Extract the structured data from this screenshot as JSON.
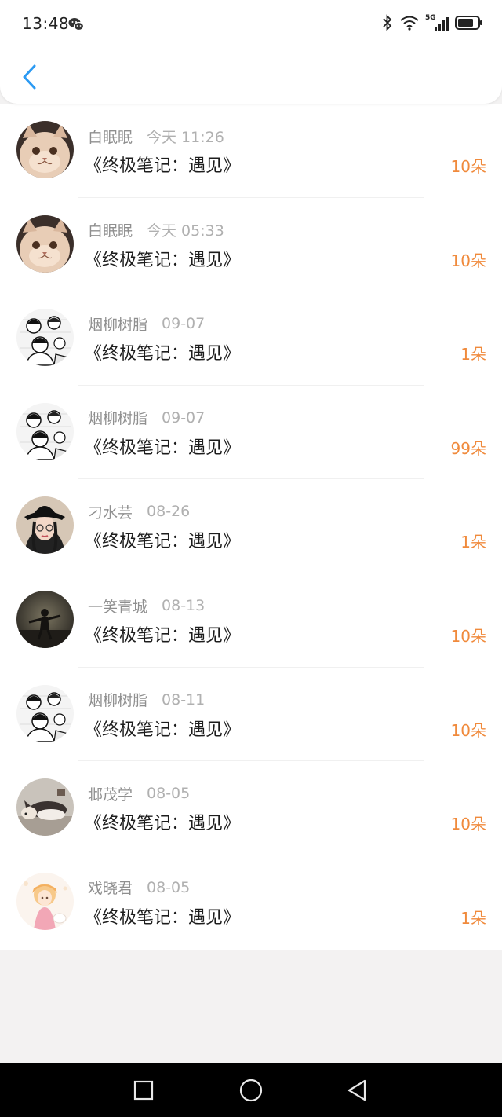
{
  "status_bar": {
    "time": "13:48",
    "network_label": "5G",
    "icons": [
      "wechat-icon",
      "bluetooth-icon",
      "wifi-icon",
      "cellular-signal-icon",
      "battery-icon"
    ]
  },
  "header": {
    "back_icon": "chevron-left-icon",
    "accent_color": "#2b9af3"
  },
  "list": {
    "amount_color": "#f08a3c",
    "items": [
      {
        "name": "白眠眠",
        "time": "今天 11:26",
        "title": "《终极笔记：遇见》",
        "amount": "10朵",
        "avatar": "cat"
      },
      {
        "name": "白眠眠",
        "time": "今天 05:33",
        "title": "《终极笔记：遇见》",
        "amount": "10朵",
        "avatar": "cat"
      },
      {
        "name": "烟柳树脂",
        "time": "09-07",
        "title": "《终极笔记：遇见》",
        "amount": "1朵",
        "avatar": "manga"
      },
      {
        "name": "烟柳树脂",
        "time": "09-07",
        "title": "《终极笔记：遇见》",
        "amount": "99朵",
        "avatar": "manga"
      },
      {
        "name": "刁水芸",
        "time": "08-26",
        "title": "《终极笔记：遇见》",
        "amount": "1朵",
        "avatar": "girl"
      },
      {
        "name": "一笑青城",
        "time": "08-13",
        "title": "《终极笔记：遇见》",
        "amount": "10朵",
        "avatar": "silhouette"
      },
      {
        "name": "烟柳树脂",
        "time": "08-11",
        "title": "《终极笔记：遇见》",
        "amount": "10朵",
        "avatar": "manga"
      },
      {
        "name": "邶茂学",
        "time": "08-05",
        "title": "《终极笔记：遇见》",
        "amount": "10朵",
        "avatar": "dog"
      },
      {
        "name": "戏晓君",
        "time": "08-05",
        "title": "《终极笔记：遇见》",
        "amount": "1朵",
        "avatar": "anime"
      }
    ]
  },
  "nav_bar": {
    "buttons": [
      "square-recents-icon",
      "circle-home-icon",
      "triangle-back-icon"
    ]
  }
}
